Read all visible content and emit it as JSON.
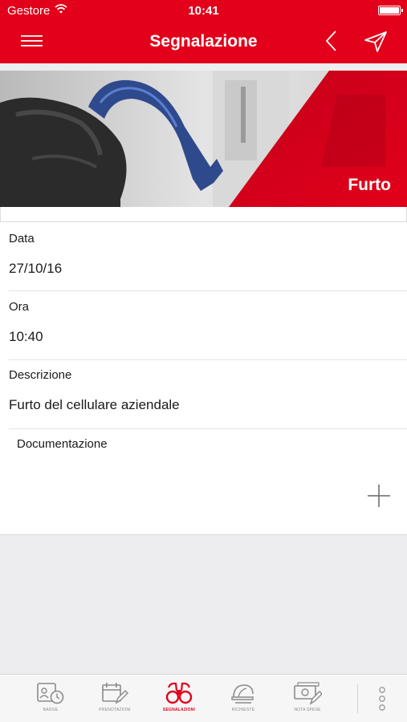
{
  "status_bar": {
    "carrier": "Gestore",
    "time": "10:41",
    "icons": [
      "wifi-icon",
      "battery-icon"
    ]
  },
  "nav": {
    "title": "Segnalazione",
    "left_icon": "menu-icon",
    "right_icons": [
      "back-chevron-icon",
      "send-icon"
    ]
  },
  "hero": {
    "caption": "Furto"
  },
  "form": {
    "fields": [
      {
        "label": "Data",
        "value": "27/10/16"
      },
      {
        "label": "Ora",
        "value": "10:40"
      },
      {
        "label": "Descrizione",
        "value": "Furto del cellulare aziendale"
      }
    ],
    "documentation": {
      "label": "Documentazione",
      "add_icon": "plus-icon"
    }
  },
  "tabbar": {
    "tabs": [
      {
        "label": "Badge",
        "icon": "badge-clock-icon",
        "active": false
      },
      {
        "label": "Prenotazioni",
        "icon": "calendar-edit-icon",
        "active": false
      },
      {
        "label": "Segnalazioni",
        "icon": "binoculars-icon",
        "active": true
      },
      {
        "label": "Richieste",
        "icon": "helmet-icon",
        "active": false
      },
      {
        "label": "Nota spese",
        "icon": "money-edit-icon",
        "active": false
      }
    ],
    "more_icon": "more-vertical-icon"
  },
  "colors": {
    "brand": "#e2001a",
    "background": "#ededef",
    "inactive_tab": "#8a8a8a"
  }
}
